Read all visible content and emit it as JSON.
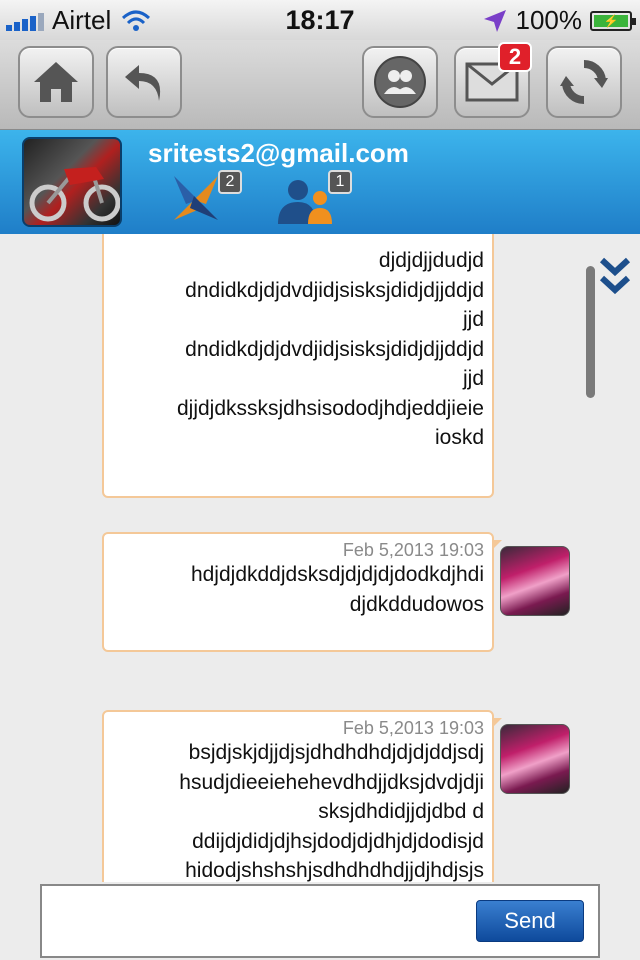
{
  "status_bar": {
    "carrier": "Airtel",
    "time": "18:17",
    "battery": "100%",
    "icons": [
      "signal-icon",
      "wifi-icon",
      "location-arrow-icon",
      "battery-charging-icon"
    ]
  },
  "toolbar": {
    "buttons": [
      "home-icon",
      "back-icon",
      "contacts-icon",
      "mail-icon",
      "refresh-icon"
    ],
    "mail_badge": "2"
  },
  "profile": {
    "email": "sritests2@gmail.com",
    "shared_count": "2",
    "friends_count": "1"
  },
  "messages": [
    {
      "lines": [
        "djdjdjjdudjd",
        "dndidkdjdjdvdjidjsisksjdidjdjjddjd",
        "jjd",
        "dndidkdjdjdvdjidjsisksjdidjdjjddjd",
        "jjd",
        "djjdjdkssksjdhsisododjhdjeddjieie",
        "ioskd"
      ]
    },
    {
      "time": "Feb 5,2013 19:03",
      "lines": [
        "hdjdjdkddjdsksdjdjdjdjdodkdjhdi",
        "djdkddudowos"
      ]
    },
    {
      "time": "Feb 5,2013 19:03",
      "lines": [
        "bsjdjskjdjjdjsjdhdhdhdjdjdjddjsdj",
        "hsudjdieeiehehevdhdjjdksjdvdjdji",
        "sksjdhdidjjdjdbd d",
        "ddijdjdidjdjhsjdodjdjdhjdjdodisjd",
        "hidodjshshshjsdhdhdhdjjdjhdjsjs"
      ]
    }
  ],
  "composer": {
    "input_value": "",
    "send_label": "Send"
  },
  "colors": {
    "header_blue": "#2a9ae0",
    "bubble_border": "#f4c898",
    "badge_red": "#e0202a",
    "send_blue": "#1d5fb5"
  }
}
